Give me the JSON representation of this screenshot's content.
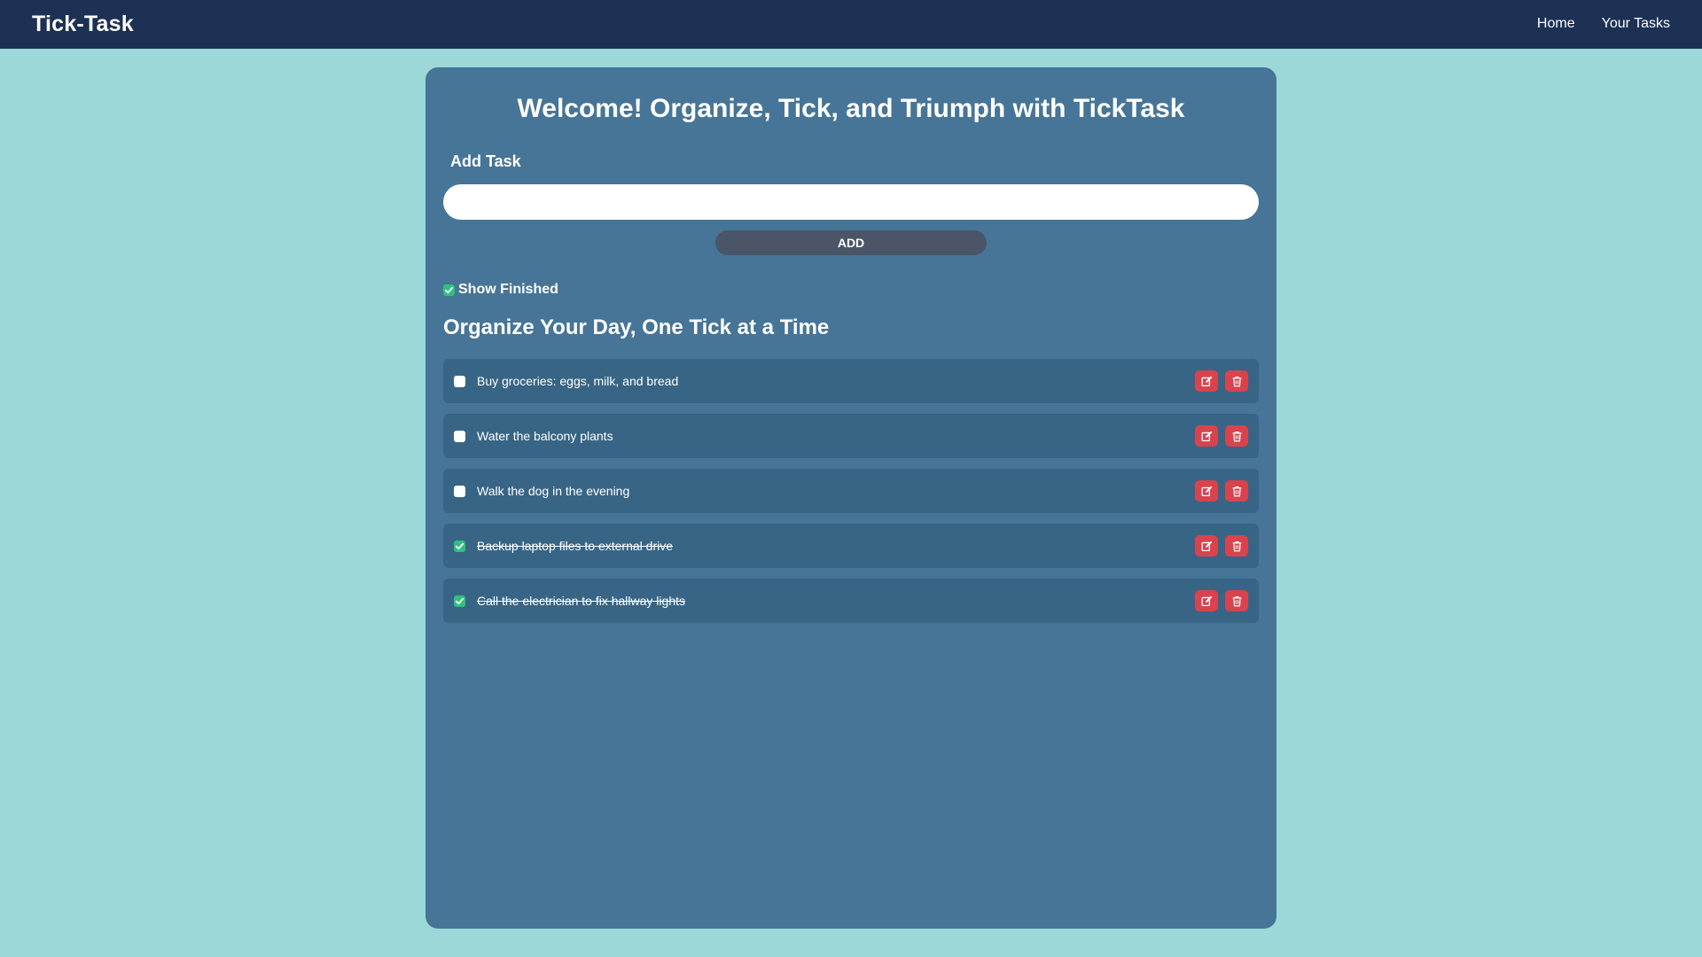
{
  "navbar": {
    "brand": "Tick-Task",
    "links": [
      {
        "label": "Home"
      },
      {
        "label": "Your Tasks"
      }
    ]
  },
  "main": {
    "title": "Welcome! Organize, Tick, and Triumph with TickTask",
    "add_label": "Add Task",
    "input_value": "",
    "add_button": "ADD",
    "show_finished_label": "Show Finished",
    "show_finished_checked": true,
    "section_title": "Organize Your Day, One Tick at a Time"
  },
  "tasks": [
    {
      "text": "Buy groceries: eggs, milk, and bread",
      "done": false
    },
    {
      "text": "Water the balcony plants",
      "done": false
    },
    {
      "text": "Walk the dog in the evening",
      "done": false
    },
    {
      "text": "Backup laptop files to external drive",
      "done": true
    },
    {
      "text": "Call the electrician to fix hallway lights",
      "done": true
    }
  ],
  "icons": {
    "edit": "edit-icon",
    "delete": "trash-icon",
    "check": "checkmark-icon"
  },
  "colors": {
    "page_background": "#9dd8d8",
    "navbar": "#1c3154",
    "card": "#467597",
    "task_row": "#386585",
    "add_button": "#4a5568",
    "action_button": "#d9434e",
    "checked": "#2ec27e"
  }
}
